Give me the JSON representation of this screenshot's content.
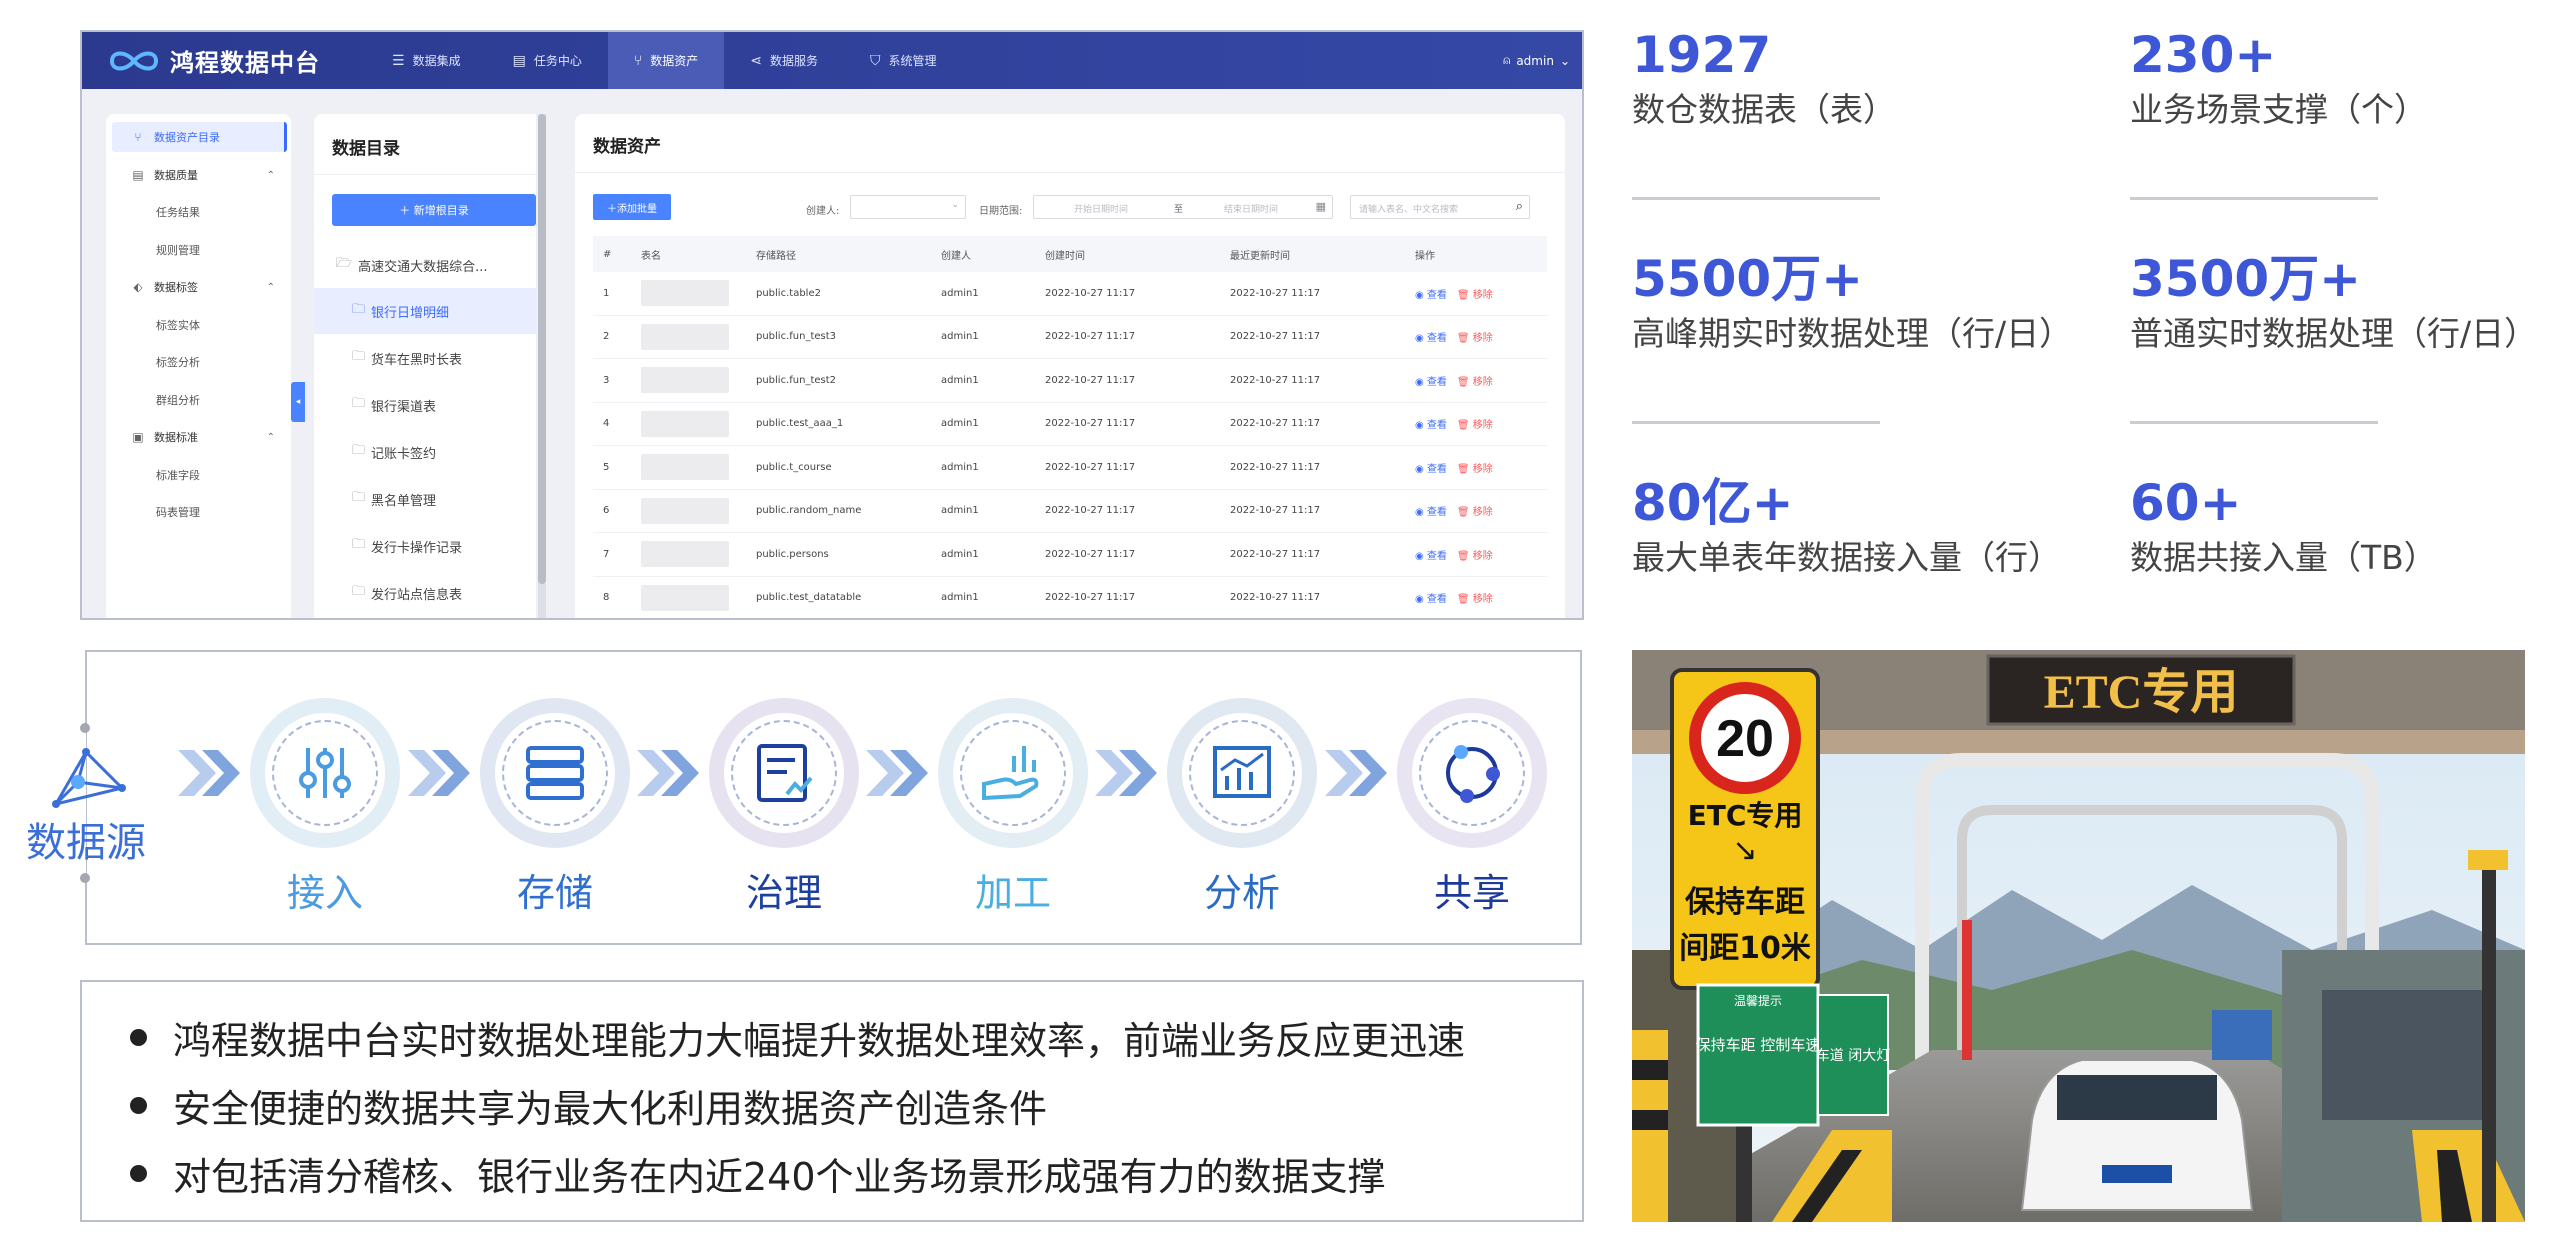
{
  "app": {
    "brand": "鸿程数据中台",
    "nav": [
      {
        "label": "数据集成",
        "icon": "list-icon"
      },
      {
        "label": "任务中心",
        "icon": "task-icon"
      },
      {
        "label": "数据资产",
        "icon": "branch-icon"
      },
      {
        "label": "数据服务",
        "icon": "share-icon"
      },
      {
        "label": "系统管理",
        "icon": "shield-icon"
      }
    ],
    "user": "admin",
    "sidebar": {
      "items": [
        {
          "label": "数据资产目录",
          "type": "group",
          "active": true
        },
        {
          "label": "数据质量",
          "type": "group"
        },
        {
          "label": "任务结果",
          "type": "sub"
        },
        {
          "label": "规则管理",
          "type": "sub"
        },
        {
          "label": "数据标签",
          "type": "group"
        },
        {
          "label": "标签实体",
          "type": "sub"
        },
        {
          "label": "标签分析",
          "type": "sub"
        },
        {
          "label": "群组分析",
          "type": "sub"
        },
        {
          "label": "数据标准",
          "type": "group"
        },
        {
          "label": "标准字段",
          "type": "sub"
        },
        {
          "label": "码表管理",
          "type": "sub"
        }
      ]
    },
    "folders": {
      "title": "数据目录",
      "add_button": "＋ 新增根目录",
      "root": "高速交通大数据综合...",
      "children": [
        "银行日增明细",
        "货车在黑时长表",
        "银行渠道表",
        "记账卡签约",
        "黑名单管理",
        "发行卡操作记录",
        "发行站点信息表"
      ]
    },
    "assets": {
      "title": "数据资产",
      "add_tag": "＋添加批量",
      "creator_label": "创建人:",
      "date_label": "日期范围:",
      "start_placeholder": "开始日期时间",
      "range_sep": "至",
      "end_placeholder": "结束日期时间",
      "search_placeholder": "请输入表名、中文名搜索",
      "columns": [
        "#",
        "表名",
        "存储路径",
        "创建人",
        "创建时间",
        "最近更新时间",
        "操作"
      ],
      "view_label": "查看",
      "remove_label": "移除",
      "rows": [
        {
          "n": "1",
          "path": "public.table2",
          "creator": "admin1",
          "created": "2022-10-27 11:17",
          "updated": "2022-10-27 11:17"
        },
        {
          "n": "2",
          "path": "public.fun_test3",
          "creator": "admin1",
          "created": "2022-10-27 11:17",
          "updated": "2022-10-27 11:17"
        },
        {
          "n": "3",
          "path": "public.fun_test2",
          "creator": "admin1",
          "created": "2022-10-27 11:17",
          "updated": "2022-10-27 11:17"
        },
        {
          "n": "4",
          "path": "public.test_aaa_1",
          "creator": "admin1",
          "created": "2022-10-27 11:17",
          "updated": "2022-10-27 11:17"
        },
        {
          "n": "5",
          "path": "public.t_course",
          "creator": "admin1",
          "created": "2022-10-27 11:17",
          "updated": "2022-10-27 11:17"
        },
        {
          "n": "6",
          "path": "public.random_name",
          "creator": "admin1",
          "created": "2022-10-27 11:17",
          "updated": "2022-10-27 11:17"
        },
        {
          "n": "7",
          "path": "public.persons",
          "creator": "admin1",
          "created": "2022-10-27 11:17",
          "updated": "2022-10-27 11:17"
        },
        {
          "n": "8",
          "path": "public.test_datatable",
          "creator": "admin1",
          "created": "2022-10-27 11:17",
          "updated": "2022-10-27 11:17"
        }
      ]
    }
  },
  "stats": [
    {
      "value": "1927",
      "label": "数仓数据表（表）"
    },
    {
      "value": "230+",
      "label": "业务场景支撑（个）"
    },
    {
      "value": "5500万+",
      "label": "高峰期实时数据处理（行/日）"
    },
    {
      "value": "3500万+",
      "label": "普通实时数据处理（行/日）"
    },
    {
      "value": "80亿+",
      "label": "最大单表年数据接入量（行）"
    },
    {
      "value": "60+",
      "label": "数据共接入量（TB）"
    }
  ],
  "pipeline": {
    "source_label": "数据源",
    "stages": [
      {
        "label": "接入",
        "icon": "sliders-icon",
        "color": "#4a9be0"
      },
      {
        "label": "存储",
        "icon": "database-icon",
        "color": "#2f6fcf"
      },
      {
        "label": "治理",
        "icon": "report-icon",
        "color": "#1d3f9e"
      },
      {
        "label": "加工",
        "icon": "hand-chart-icon",
        "color": "#4aaee0"
      },
      {
        "label": "分析",
        "icon": "bar-chart-icon",
        "color": "#2a6cc4"
      },
      {
        "label": "共享",
        "icon": "share-circle-icon",
        "color": "#1d3a9a"
      }
    ]
  },
  "bullets": [
    "鸿程数据中台实时数据处理能力大幅提升数据处理效率，前端业务反应更迅速",
    "安全便捷的数据共享为最大化利用数据资产创造条件",
    "对包括清分稽核、银行业务在内近240个业务场景形成强有力的数据支撑"
  ],
  "photo": {
    "etc_sign": "ETC专用",
    "speed_limit": "20",
    "yellow_sign_line1": "ETC专用",
    "yellow_sign_line2": "保持车距",
    "yellow_sign_line3": "间距10米",
    "green_sign_title": "温馨提示",
    "green_sign_body": "保持车距 控制车速",
    "green_sign_side": "车道 闭大灯"
  },
  "colors": {
    "accent": "#3d57d6",
    "primary_blue": "#4a83ff",
    "nav_bg": "#2b3a8f"
  }
}
